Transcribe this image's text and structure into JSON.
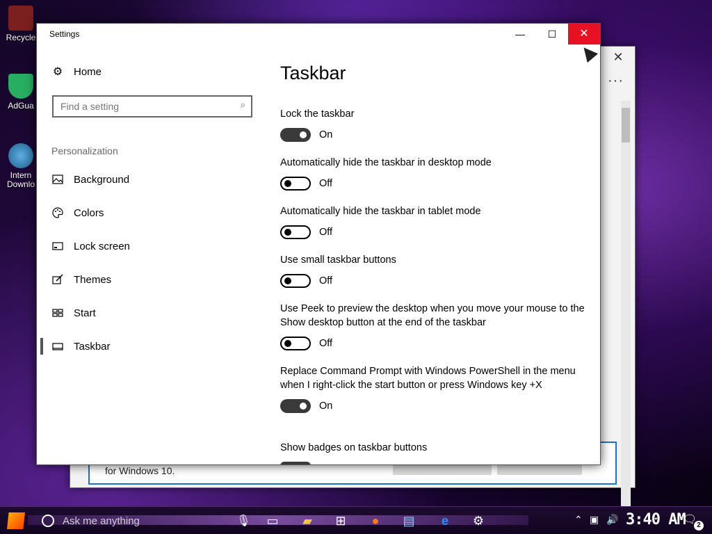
{
  "desktop": {
    "icons": [
      {
        "label": "Recycle",
        "icon": "recycle-bin-icon",
        "color": "#c0392b"
      },
      {
        "label": "AdGua",
        "icon": "adguard-shield-icon",
        "color": "#27ae60"
      },
      {
        "label": "Intern\nDownlo",
        "icon": "internet-download-manager-icon",
        "color": "#2e86de"
      }
    ]
  },
  "background_window": {
    "close_glyph": "✕",
    "more_glyph": "···",
    "panel_text": "for Windows 10."
  },
  "settings": {
    "title": "Settings",
    "controls": {
      "minimize": "—",
      "maximize": "☐",
      "close": "✕"
    },
    "home_label": "Home",
    "search": {
      "placeholder": "Find a setting",
      "icon": "search-icon"
    },
    "section_header": "Personalization",
    "nav_items": [
      {
        "label": "Background",
        "icon": "picture-icon"
      },
      {
        "label": "Colors",
        "icon": "palette-icon"
      },
      {
        "label": "Lock screen",
        "icon": "lock-screen-icon"
      },
      {
        "label": "Themes",
        "icon": "brush-icon"
      },
      {
        "label": "Start",
        "icon": "start-tiles-icon"
      },
      {
        "label": "Taskbar",
        "icon": "taskbar-icon",
        "active": true
      }
    ],
    "page_title": "Taskbar",
    "options": [
      {
        "label": "Lock the taskbar",
        "state": "On"
      },
      {
        "label": "Automatically hide the taskbar in desktop mode",
        "state": "Off"
      },
      {
        "label": "Automatically hide the taskbar in tablet mode",
        "state": "Off"
      },
      {
        "label": "Use small taskbar buttons",
        "state": "Off"
      },
      {
        "label": "Use Peek to preview the desktop when you move your mouse to the Show desktop button at the end of the taskbar",
        "state": "Off"
      },
      {
        "label": "Replace Command Prompt with Windows PowerShell in the menu when I right-click the start button or press Windows key +X",
        "state": "On"
      },
      {
        "label": "Show badges on taskbar buttons",
        "state": ""
      }
    ]
  },
  "taskbar": {
    "search_placeholder": "Ask me anything",
    "clock": "3:40 AM",
    "notification_count": "2",
    "apps": [
      "task-view-icon",
      "file-explorer-icon",
      "store-icon",
      "firefox-icon",
      "remote-desktop-icon",
      "edge-icon",
      "settings-gear-icon"
    ]
  }
}
